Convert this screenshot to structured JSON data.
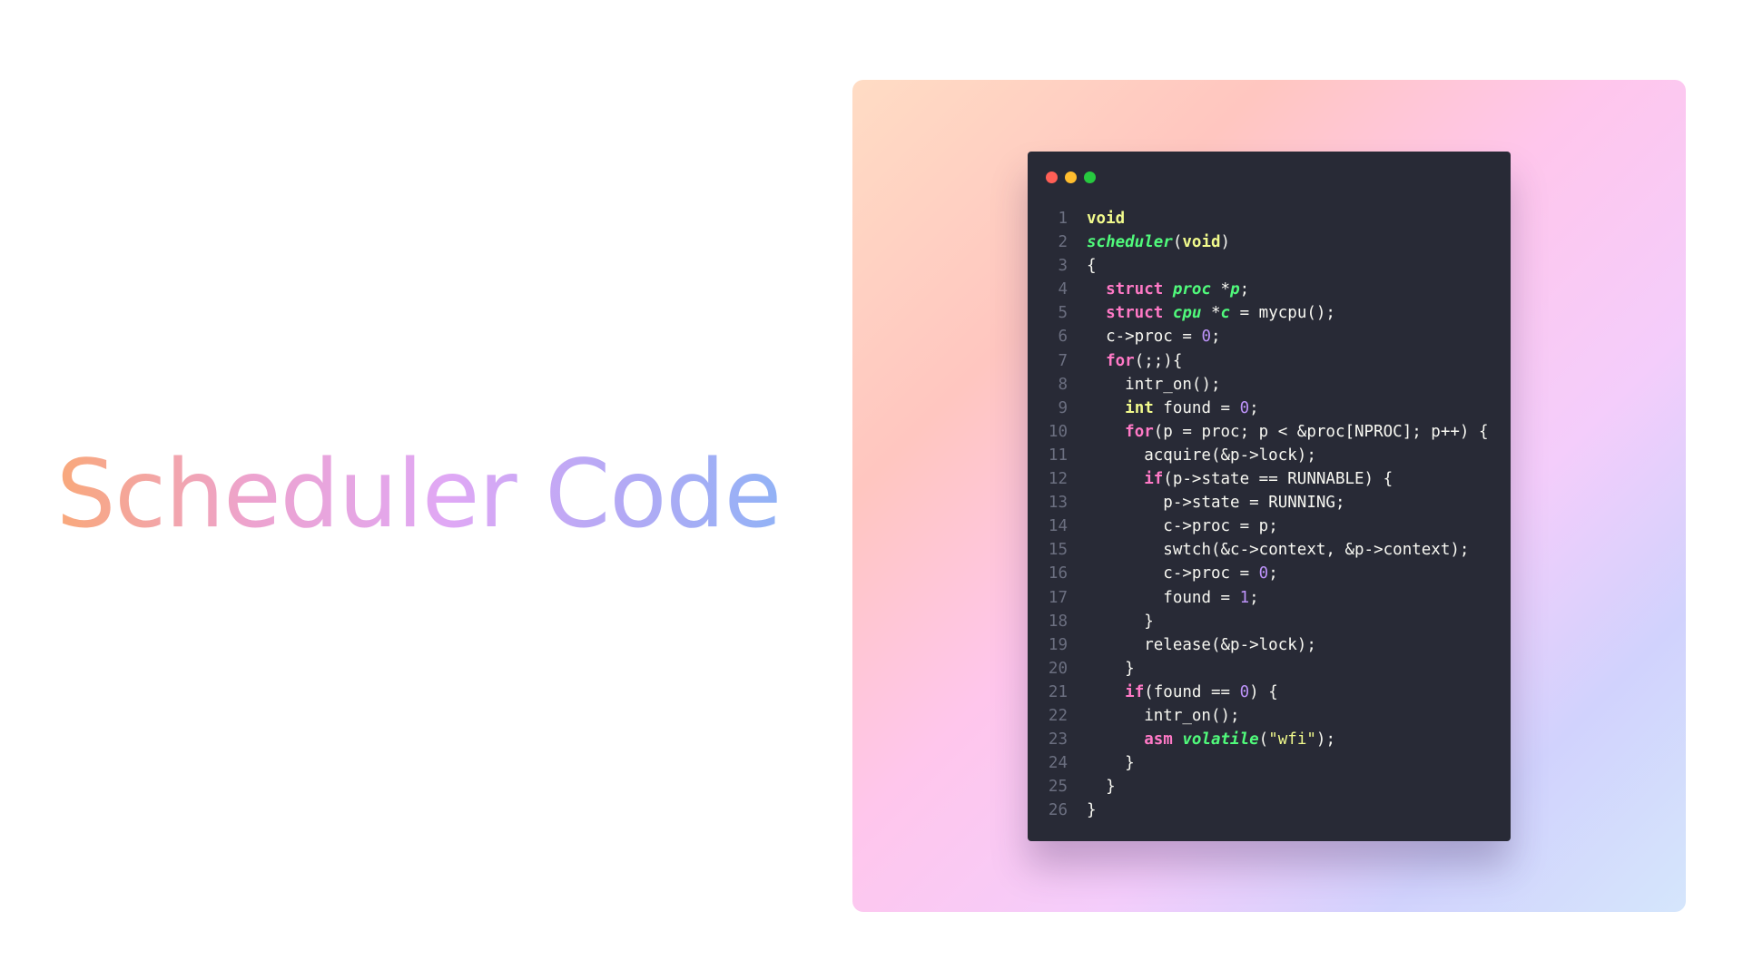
{
  "slide": {
    "title": "Scheduler Code"
  },
  "code_window": {
    "traffic_lights": [
      {
        "name": "close",
        "color": "#ff5f56"
      },
      {
        "name": "minimize",
        "color": "#ffbd2e"
      },
      {
        "name": "maximize",
        "color": "#27c93f"
      }
    ],
    "lines": [
      {
        "n": "1",
        "indent": "",
        "tokens": [
          {
            "t": "void",
            "k": "type"
          }
        ]
      },
      {
        "n": "2",
        "indent": "",
        "tokens": [
          {
            "t": "scheduler",
            "k": "fn"
          },
          {
            "t": "(",
            "k": "plain"
          },
          {
            "t": "void",
            "k": "type"
          },
          {
            "t": ")",
            "k": "plain"
          }
        ]
      },
      {
        "n": "3",
        "indent": "",
        "tokens": [
          {
            "t": "{",
            "k": "plain"
          }
        ]
      },
      {
        "n": "4",
        "indent": "  ",
        "tokens": [
          {
            "t": "struct",
            "k": "kw"
          },
          {
            "t": " ",
            "k": "plain"
          },
          {
            "t": "proc",
            "k": "fn"
          },
          {
            "t": " *",
            "k": "plain"
          },
          {
            "t": "p",
            "k": "fn"
          },
          {
            "t": ";",
            "k": "plain"
          }
        ]
      },
      {
        "n": "5",
        "indent": "  ",
        "tokens": [
          {
            "t": "struct",
            "k": "kw"
          },
          {
            "t": " ",
            "k": "plain"
          },
          {
            "t": "cpu",
            "k": "fn"
          },
          {
            "t": " *",
            "k": "plain"
          },
          {
            "t": "c",
            "k": "fn"
          },
          {
            "t": " = mycpu();",
            "k": "plain"
          }
        ]
      },
      {
        "n": "6",
        "indent": "  ",
        "tokens": [
          {
            "t": "c->proc = ",
            "k": "plain"
          },
          {
            "t": "0",
            "k": "num"
          },
          {
            "t": ";",
            "k": "plain"
          }
        ]
      },
      {
        "n": "7",
        "indent": "  ",
        "tokens": [
          {
            "t": "for",
            "k": "kw"
          },
          {
            "t": "(;;){",
            "k": "plain"
          }
        ]
      },
      {
        "n": "8",
        "indent": "    ",
        "tokens": [
          {
            "t": "intr_on();",
            "k": "plain"
          }
        ]
      },
      {
        "n": "9",
        "indent": "    ",
        "tokens": [
          {
            "t": "int",
            "k": "type"
          },
          {
            "t": " found = ",
            "k": "plain"
          },
          {
            "t": "0",
            "k": "num"
          },
          {
            "t": ";",
            "k": "plain"
          }
        ]
      },
      {
        "n": "10",
        "indent": "    ",
        "tokens": [
          {
            "t": "for",
            "k": "kw"
          },
          {
            "t": "(p = proc; p < &proc[NPROC]; p++) {",
            "k": "plain"
          }
        ]
      },
      {
        "n": "11",
        "indent": "      ",
        "tokens": [
          {
            "t": "acquire(&p->lock);",
            "k": "plain"
          }
        ]
      },
      {
        "n": "12",
        "indent": "      ",
        "tokens": [
          {
            "t": "if",
            "k": "kw"
          },
          {
            "t": "(p->state == RUNNABLE) {",
            "k": "plain"
          }
        ]
      },
      {
        "n": "13",
        "indent": "        ",
        "tokens": [
          {
            "t": "p->state = RUNNING;",
            "k": "plain"
          }
        ]
      },
      {
        "n": "14",
        "indent": "        ",
        "tokens": [
          {
            "t": "c->proc = p;",
            "k": "plain"
          }
        ]
      },
      {
        "n": "15",
        "indent": "        ",
        "tokens": [
          {
            "t": "swtch(&c->context, &p->context);",
            "k": "plain"
          }
        ]
      },
      {
        "n": "16",
        "indent": "        ",
        "tokens": [
          {
            "t": "c->proc = ",
            "k": "plain"
          },
          {
            "t": "0",
            "k": "num"
          },
          {
            "t": ";",
            "k": "plain"
          }
        ]
      },
      {
        "n": "17",
        "indent": "        ",
        "tokens": [
          {
            "t": "found = ",
            "k": "plain"
          },
          {
            "t": "1",
            "k": "num"
          },
          {
            "t": ";",
            "k": "plain"
          }
        ]
      },
      {
        "n": "18",
        "indent": "      ",
        "tokens": [
          {
            "t": "}",
            "k": "plain"
          }
        ]
      },
      {
        "n": "19",
        "indent": "      ",
        "tokens": [
          {
            "t": "release(&p->lock);",
            "k": "plain"
          }
        ]
      },
      {
        "n": "20",
        "indent": "    ",
        "tokens": [
          {
            "t": "}",
            "k": "plain"
          }
        ]
      },
      {
        "n": "21",
        "indent": "    ",
        "tokens": [
          {
            "t": "if",
            "k": "kw"
          },
          {
            "t": "(found == ",
            "k": "plain"
          },
          {
            "t": "0",
            "k": "num"
          },
          {
            "t": ") {",
            "k": "plain"
          }
        ]
      },
      {
        "n": "22",
        "indent": "      ",
        "tokens": [
          {
            "t": "intr_on();",
            "k": "plain"
          }
        ]
      },
      {
        "n": "23",
        "indent": "      ",
        "tokens": [
          {
            "t": "asm",
            "k": "kw"
          },
          {
            "t": " ",
            "k": "plain"
          },
          {
            "t": "volatile",
            "k": "fn"
          },
          {
            "t": "(",
            "k": "plain"
          },
          {
            "t": "\"wfi\"",
            "k": "str"
          },
          {
            "t": ");",
            "k": "plain"
          }
        ]
      },
      {
        "n": "24",
        "indent": "    ",
        "tokens": [
          {
            "t": "}",
            "k": "plain"
          }
        ]
      },
      {
        "n": "25",
        "indent": "  ",
        "tokens": [
          {
            "t": "}",
            "k": "plain"
          }
        ]
      },
      {
        "n": "26",
        "indent": "",
        "tokens": [
          {
            "t": "}",
            "k": "plain"
          }
        ]
      }
    ]
  },
  "colors": {
    "editor_background": "#282a36",
    "line_number": "#6b6f80",
    "keyword": "#ff79c6",
    "type": "#f1fa8c",
    "function": "#50fa7b",
    "number": "#bd93f9",
    "string": "#f1fa8c",
    "plain_text": "#f8f8f2"
  }
}
